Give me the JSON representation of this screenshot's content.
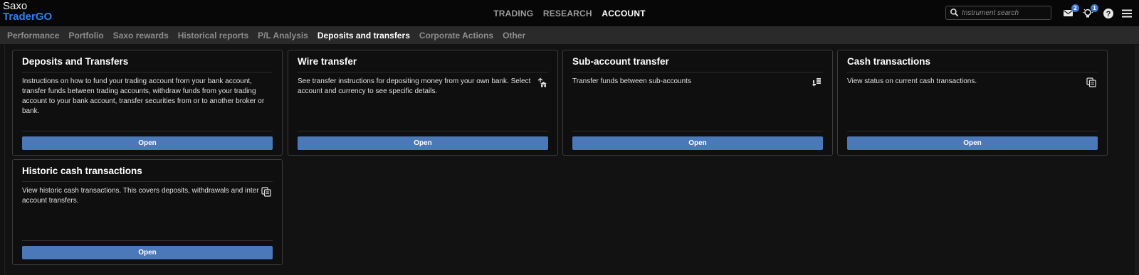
{
  "brand": {
    "line1": "Saxo",
    "line2": "TraderGO"
  },
  "main_nav": [
    {
      "label": "TRADING",
      "active": false
    },
    {
      "label": "RESEARCH",
      "active": false
    },
    {
      "label": "ACCOUNT",
      "active": true
    }
  ],
  "search": {
    "placeholder": "Instrument search",
    "value": ""
  },
  "top_icons": {
    "messages": {
      "icon": "envelope-icon",
      "badge": "2"
    },
    "notifications": {
      "icon": "lightbulb-icon",
      "badge": "1"
    },
    "help": {
      "icon": "help-icon"
    },
    "menu": {
      "icon": "hamburger-menu-icon"
    }
  },
  "sub_nav": [
    {
      "label": "Performance",
      "active": false
    },
    {
      "label": "Portfolio",
      "active": false
    },
    {
      "label": "Saxo rewards",
      "active": false
    },
    {
      "label": "Historical reports",
      "active": false
    },
    {
      "label": "P/L Analysis",
      "active": false
    },
    {
      "label": "Deposits and transfers",
      "active": true
    },
    {
      "label": "Corporate Actions",
      "active": false
    },
    {
      "label": "Other",
      "active": false
    }
  ],
  "cards": [
    {
      "title": "Deposits and Transfers",
      "description": "Instructions on how to fund your trading account from your bank account, transfer funds between trading accounts, withdraw funds from your trading account to your bank account, transfer securities from or to another broker or bank.",
      "icon": "",
      "button": "Open"
    },
    {
      "title": "Wire transfer",
      "description": "See transfer instructions for depositing money from your own bank. Select account and currency to see specific details.",
      "icon": "bank-transfer-icon",
      "button": "Open"
    },
    {
      "title": "Sub-account transfer",
      "description": "Transfer funds between sub-accounts",
      "icon": "account-transfer-icon",
      "button": "Open"
    },
    {
      "title": "Cash transactions",
      "description": "View status on current cash transactions.",
      "icon": "transactions-icon",
      "button": "Open"
    },
    {
      "title": "Historic cash transactions",
      "description": "View historic cash transactions. This covers deposits, withdrawals and inter account transfers.",
      "icon": "transactions-icon",
      "button": "Open"
    }
  ],
  "colors": {
    "accent": "#2f7ff0",
    "button": "#4b78b8",
    "badge": "#3a78d6",
    "background": "#121212"
  }
}
